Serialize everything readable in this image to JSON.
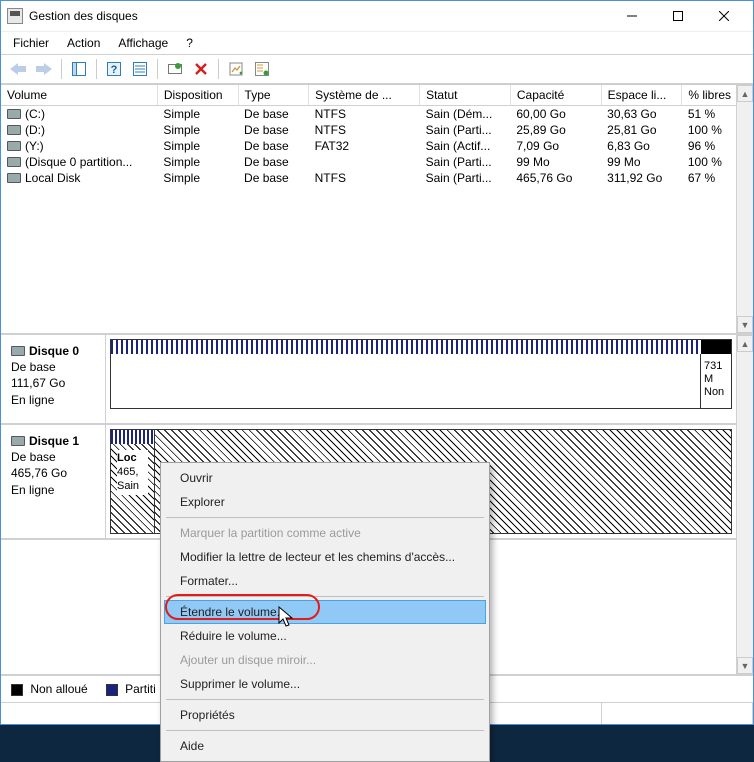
{
  "window": {
    "title": "Gestion des disques"
  },
  "menubar": {
    "file": "Fichier",
    "action": "Action",
    "view": "Affichage",
    "help": "?"
  },
  "columns": {
    "volume": "Volume",
    "disposition": "Disposition",
    "type": "Type",
    "fs": "Système de ...",
    "status": "Statut",
    "capacity": "Capacité",
    "free": "Espace li...",
    "pctfree": "% libres"
  },
  "volumes": [
    {
      "name": "(C:)",
      "disposition": "Simple",
      "type": "De base",
      "fs": "NTFS",
      "status": "Sain (Dém...",
      "capacity": "60,00 Go",
      "free": "30,63 Go",
      "pct": "51 %"
    },
    {
      "name": "(D:)",
      "disposition": "Simple",
      "type": "De base",
      "fs": "NTFS",
      "status": "Sain (Parti...",
      "capacity": "25,89 Go",
      "free": "25,81 Go",
      "pct": "100 %"
    },
    {
      "name": "(Y:)",
      "disposition": "Simple",
      "type": "De base",
      "fs": "FAT32",
      "status": "Sain (Actif...",
      "capacity": "7,09 Go",
      "free": "6,83 Go",
      "pct": "96 %"
    },
    {
      "name": "(Disque 0 partition...",
      "disposition": "Simple",
      "type": "De base",
      "fs": "",
      "status": "Sain (Parti...",
      "capacity": "99 Mo",
      "free": "99 Mo",
      "pct": "100 %"
    },
    {
      "name": "Local Disk",
      "disposition": "Simple",
      "type": "De base",
      "fs": "NTFS",
      "status": "Sain (Parti...",
      "capacity": "465,76 Go",
      "free": "311,92 Go",
      "pct": "67 %"
    }
  ],
  "disks": [
    {
      "name": "Disque 0",
      "type": "De base",
      "size": "111,67 Go",
      "state": "En ligne",
      "unalloc_label1": "731 M",
      "unalloc_label2": "Non "
    },
    {
      "name": "Disque 1",
      "type": "De base",
      "size": "465,76 Go",
      "state": "En ligne",
      "part_label1": "Loc",
      "part_label2": "465,",
      "part_label3": "Sain"
    }
  ],
  "legend": {
    "unallocated": "Non alloué",
    "primary": "Partiti"
  },
  "context_menu": {
    "open": "Ouvrir",
    "explore": "Explorer",
    "mark_active": "Marquer la partition comme active",
    "change_letter": "Modifier la lettre de lecteur et les chemins d'accès...",
    "format": "Formater...",
    "extend": "Étendre le volume...",
    "shrink": "Réduire le volume...",
    "add_mirror": "Ajouter un disque miroir...",
    "delete": "Supprimer le volume...",
    "properties": "Propriétés",
    "help": "Aide"
  }
}
